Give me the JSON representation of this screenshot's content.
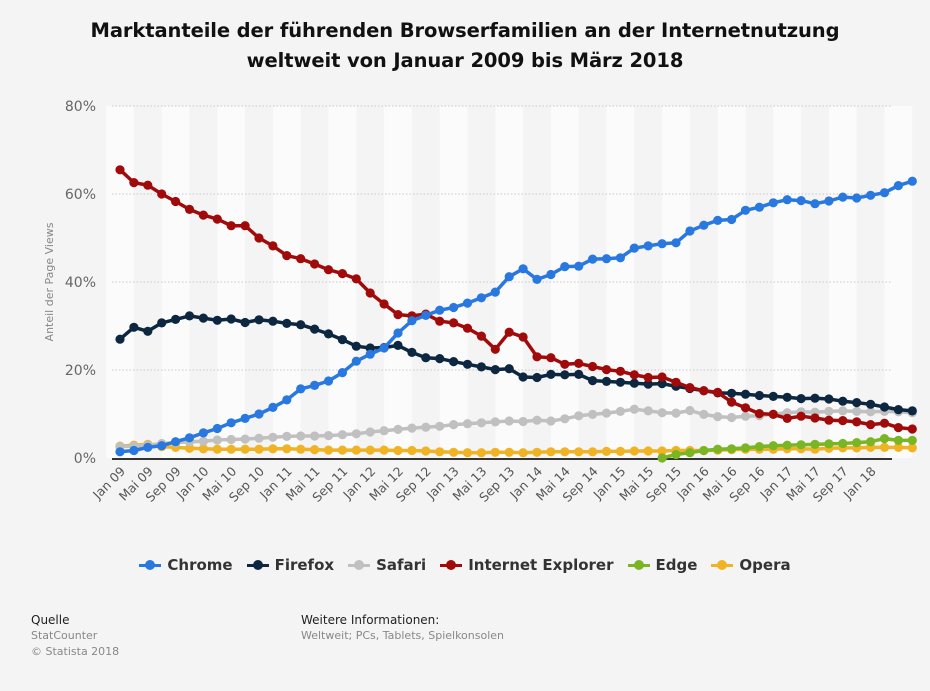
{
  "title_line1": "Marktanteile der führenden Browserfamilien an der Internetnutzung",
  "title_line2": "weltweit von Januar 2009 bis März 2018",
  "footer": {
    "source_heading": "Quelle",
    "source": "StatCounter",
    "copyright": "© Statista 2018",
    "info_heading": "Weitere Informationen:",
    "info": "Weltweit; PCs, Tablets, Spielkonsolen"
  },
  "chart_data": {
    "type": "line",
    "title": "Marktanteile der führenden Browserfamilien an der Internetnutzung weltweit von Januar 2009 bis März 2018",
    "xlabel": "",
    "ylabel": "Anteil der Page Views",
    "ylim": [
      0,
      80
    ],
    "y_ticks": [
      "0%",
      "20%",
      "40%",
      "60%",
      "80%"
    ],
    "y_tick_values": [
      0,
      20,
      40,
      60,
      80
    ],
    "x_interval": "bimonthly (Jan 2009 – Mar 2018)",
    "x_tick_labels": [
      "Jan 09",
      "Mai 09",
      "Sep 09",
      "Jan 10",
      "Mai 10",
      "Sep 10",
      "Jan 11",
      "Mai 11",
      "Sep 11",
      "Jan 12",
      "Mai 12",
      "Sep 12",
      "Jan 13",
      "Mai 13",
      "Sep 13",
      "Jan 14",
      "Mai 14",
      "Sep 14",
      "Jan 15",
      "Mai 15",
      "Sep 15",
      "Jan 16",
      "Mai 16",
      "Sep 16",
      "Jan 17",
      "Mai 17",
      "Sep 17",
      "Jan 18"
    ],
    "grid": true,
    "legend_position": "bottom",
    "series": [
      {
        "name": "Chrome",
        "color": "#2878e0",
        "values": [
          1.4,
          1.7,
          2.4,
          2.8,
          3.7,
          4.6,
          5.7,
          6.7,
          8.0,
          9.0,
          10.0,
          11.5,
          13.2,
          15.7,
          16.5,
          17.5,
          19.4,
          22.0,
          23.6,
          25.0,
          28.4,
          31.2,
          32.4,
          33.6,
          34.2,
          35.2,
          36.4,
          37.7,
          41.2,
          43.0,
          40.6,
          41.7,
          43.5,
          43.6,
          45.2,
          45.3,
          45.5,
          47.7,
          48.2,
          48.7,
          48.9,
          51.6,
          52.9,
          54.0,
          54.2,
          56.3,
          57.0,
          58.0,
          58.7,
          58.5,
          57.8,
          58.4,
          59.3,
          59.1,
          59.7,
          60.3,
          61.9,
          62.9
        ]
      },
      {
        "name": "Firefox",
        "color": "#0d2740",
        "values": [
          27.0,
          29.7,
          28.8,
          30.7,
          31.5,
          32.3,
          31.8,
          31.3,
          31.6,
          30.8,
          31.4,
          31.1,
          30.6,
          30.3,
          29.3,
          28.2,
          26.9,
          25.4,
          25.0,
          25.1,
          25.6,
          24.0,
          22.8,
          22.6,
          21.9,
          21.3,
          20.7,
          20.1,
          20.3,
          18.4,
          18.3,
          19.0,
          18.9,
          19.0,
          17.6,
          17.4,
          17.2,
          17.0,
          16.8,
          16.9,
          16.3,
          15.8,
          15.3,
          14.8,
          14.7,
          14.5,
          14.2,
          14.0,
          13.8,
          13.5,
          13.6,
          13.4,
          12.9,
          12.6,
          12.2,
          11.6,
          11.0,
          10.7
        ]
      },
      {
        "name": "Safari",
        "color": "#c0c0c0",
        "values": [
          2.6,
          2.7,
          2.9,
          3.3,
          3.5,
          3.7,
          3.8,
          4.1,
          4.2,
          4.3,
          4.5,
          4.7,
          4.9,
          5.0,
          5.0,
          5.1,
          5.3,
          5.5,
          5.9,
          6.2,
          6.5,
          6.8,
          7.0,
          7.2,
          7.6,
          7.8,
          8.0,
          8.2,
          8.4,
          8.3,
          8.6,
          8.4,
          8.9,
          9.6,
          9.9,
          10.2,
          10.6,
          11.1,
          10.7,
          10.3,
          10.2,
          10.8,
          9.9,
          9.4,
          9.2,
          9.5,
          9.6,
          10.0,
          10.3,
          10.5,
          10.4,
          10.6,
          10.7,
          10.6,
          10.5,
          10.6,
          10.5,
          10.3
        ]
      },
      {
        "name": "Internet Explorer",
        "color": "#a10a0a",
        "values": [
          65.5,
          62.6,
          62.0,
          60.0,
          58.3,
          56.5,
          55.2,
          54.3,
          52.8,
          52.8,
          50.0,
          48.2,
          46.0,
          45.3,
          44.1,
          42.8,
          41.9,
          40.7,
          37.5,
          35.0,
          32.6,
          32.3,
          32.7,
          31.1,
          30.7,
          29.5,
          27.7,
          24.7,
          28.6,
          27.5,
          23.0,
          22.8,
          21.3,
          21.5,
          20.8,
          20.1,
          19.7,
          18.9,
          18.3,
          18.4,
          17.2,
          16.0,
          15.3,
          14.9,
          12.7,
          11.4,
          10.1,
          9.9,
          9.0,
          9.5,
          9.1,
          8.6,
          8.5,
          8.2,
          7.6,
          7.9,
          6.9,
          6.6
        ]
      },
      {
        "name": "Edge",
        "color": "#7ab523",
        "values": [
          null,
          null,
          null,
          null,
          null,
          null,
          null,
          null,
          null,
          null,
          null,
          null,
          null,
          null,
          null,
          null,
          null,
          null,
          null,
          null,
          null,
          null,
          null,
          null,
          null,
          null,
          null,
          null,
          null,
          null,
          null,
          null,
          null,
          null,
          null,
          null,
          null,
          null,
          null,
          0.0,
          0.8,
          1.2,
          1.7,
          2.0,
          2.1,
          2.3,
          2.6,
          2.8,
          2.9,
          3.0,
          3.1,
          3.2,
          3.3,
          3.5,
          3.7,
          4.4,
          4.0,
          4.0
        ]
      },
      {
        "name": "Opera",
        "color": "#f0b323",
        "values": [
          2.7,
          2.9,
          3.1,
          2.6,
          2.4,
          2.2,
          2.1,
          2.0,
          2.0,
          2.0,
          2.0,
          2.1,
          2.1,
          2.0,
          1.9,
          1.8,
          1.8,
          1.8,
          1.8,
          1.8,
          1.7,
          1.7,
          1.6,
          1.4,
          1.3,
          1.2,
          1.2,
          1.3,
          1.3,
          1.2,
          1.3,
          1.4,
          1.4,
          1.4,
          1.4,
          1.5,
          1.5,
          1.6,
          1.6,
          1.6,
          1.7,
          1.7,
          1.7,
          1.8,
          1.9,
          2.0,
          2.0,
          2.0,
          2.1,
          2.1,
          2.0,
          2.2,
          2.3,
          2.3,
          2.4,
          2.4,
          2.4,
          2.3
        ]
      }
    ]
  }
}
